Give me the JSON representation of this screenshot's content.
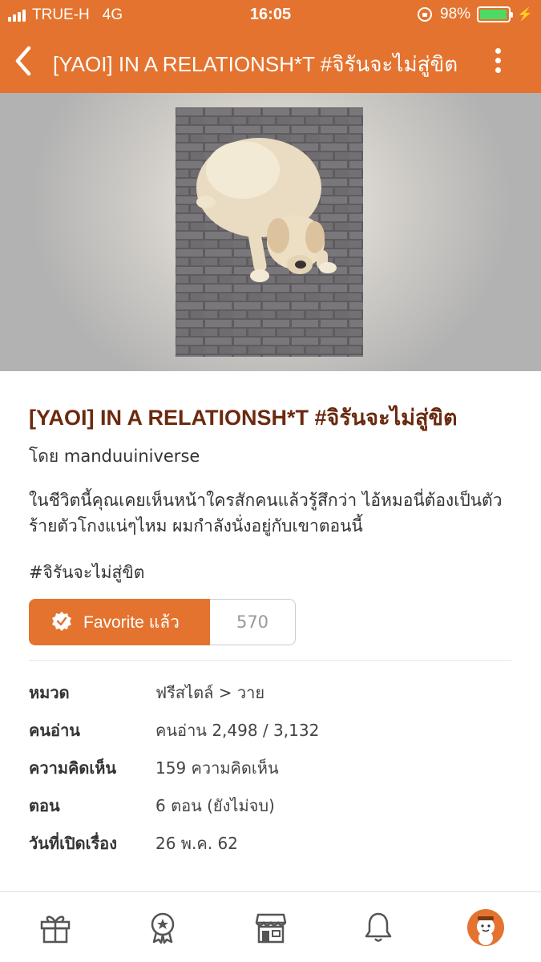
{
  "status_bar": {
    "carrier": "TRUE-H",
    "network": "4G",
    "time": "16:05",
    "battery": "98%",
    "battery_level": 0.98
  },
  "nav": {
    "title": "[YAOI] IN A RELATIONSH*T #จิรันจะไม่สู่ขิต"
  },
  "story": {
    "title": "[YAOI] IN A RELATIONSH*T #จิรันจะไม่สู่ขิต",
    "author": "โดย manduuiniverse",
    "description": "ในชีวิตนี้คุณเคยเห็นหน้าใครสักคนแล้วรู้สึกว่า ไอ้หมอนี่ต้องเป็นตัวร้ายตัวโกงแน่ๆไหม ผมกำลังนั่งอยู่กับเขาตอนนี้",
    "tag": "#จิรันจะไม่สู่ขิต",
    "favorite_label": "Favorite แล้ว",
    "favorite_count": "570"
  },
  "info": [
    {
      "label": "หมวด",
      "value": "ฟรีสไตล์ > วาย"
    },
    {
      "label": "คนอ่าน",
      "value": "คนอ่าน 2,498 / 3,132"
    },
    {
      "label": "ความคิดเห็น",
      "value": "159 ความคิดเห็น"
    },
    {
      "label": "ตอน",
      "value": "6 ตอน (ยังไม่จบ)"
    },
    {
      "label": "วันที่เปิดเรื่อง",
      "value": "26 พ.ค. 62"
    }
  ],
  "tabbar": {
    "icons": [
      "gift-icon",
      "award-icon",
      "shop-icon",
      "bell-icon",
      "profile-icon"
    ]
  },
  "colors": {
    "brand": "#E4732F",
    "title": "#6b2a0f"
  }
}
